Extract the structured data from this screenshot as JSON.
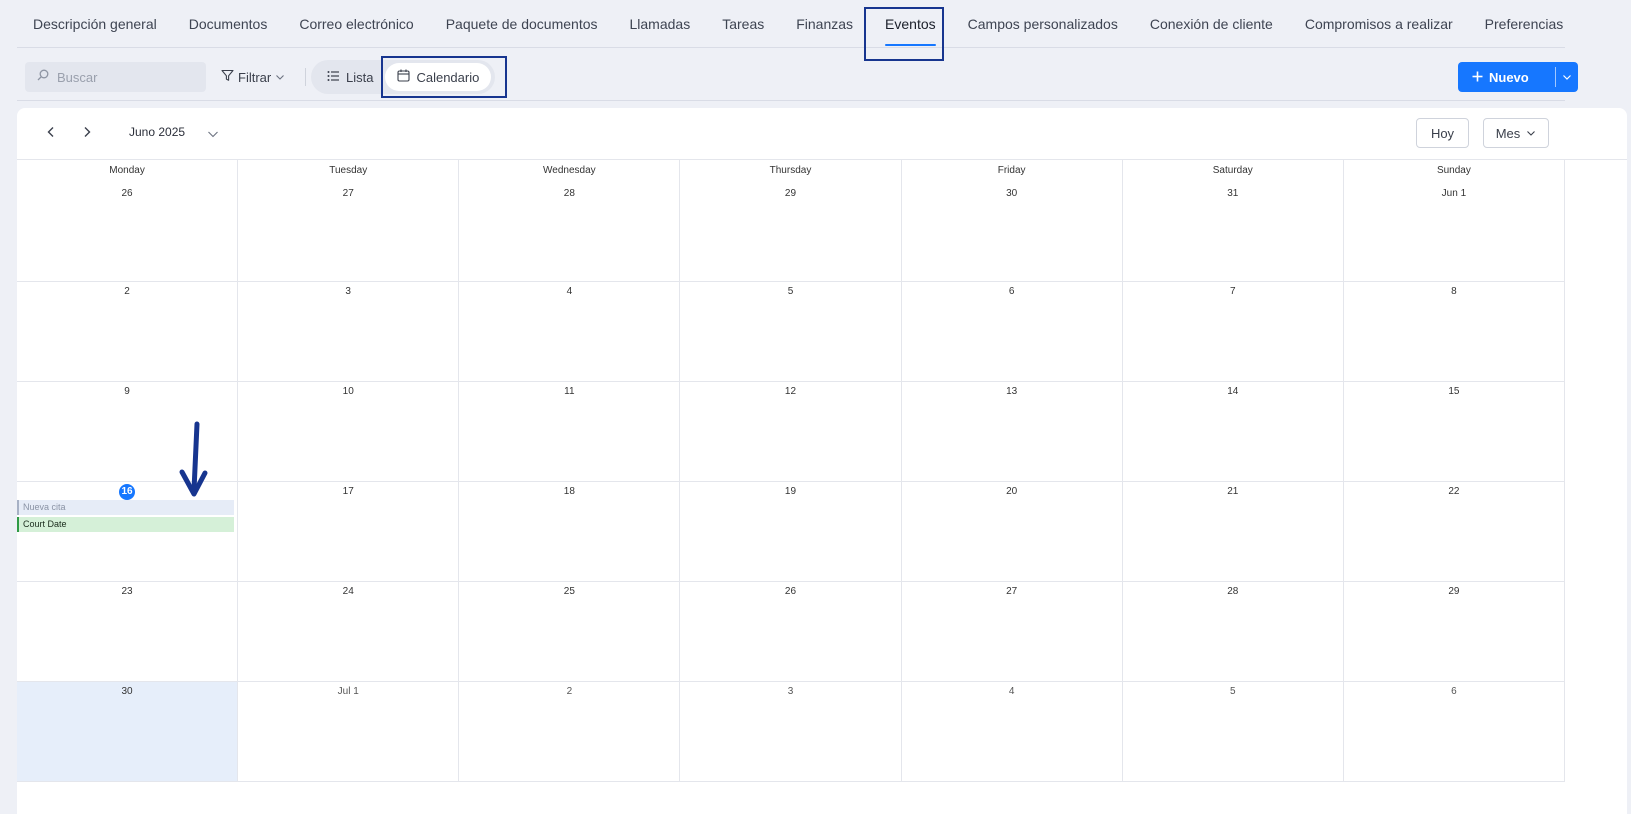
{
  "tabs": [
    {
      "label": "Descripción general"
    },
    {
      "label": "Documentos"
    },
    {
      "label": "Correo electrónico"
    },
    {
      "label": "Paquete de documentos"
    },
    {
      "label": "Llamadas"
    },
    {
      "label": "Tareas"
    },
    {
      "label": "Finanzas"
    },
    {
      "label": "Eventos",
      "active": true
    },
    {
      "label": "Campos personalizados"
    },
    {
      "label": "Conexión de cliente"
    },
    {
      "label": "Compromisos a realizar"
    },
    {
      "label": "Preferencias"
    }
  ],
  "toolbar": {
    "search_placeholder": "Buscar",
    "filter_label": "Filtrar",
    "list_label": "Lista",
    "calendar_label": "Calendario",
    "new_label": "Nuevo"
  },
  "calendar": {
    "month_label": "Juno 2025",
    "today_button": "Hoy",
    "view_button": "Mes",
    "weekdays": [
      "Monday",
      "Tuesday",
      "Wednesday",
      "Thursday",
      "Friday",
      "Saturday",
      "Sunday"
    ],
    "weeks": [
      [
        "26",
        "27",
        "28",
        "29",
        "30",
        "31",
        "Jun 1"
      ],
      [
        "2",
        "3",
        "4",
        "5",
        "6",
        "7",
        "8"
      ],
      [
        "9",
        "10",
        "11",
        "12",
        "13",
        "14",
        "15"
      ],
      [
        "16",
        "17",
        "18",
        "19",
        "20",
        "21",
        "22"
      ],
      [
        "23",
        "24",
        "25",
        "26",
        "27",
        "28",
        "29"
      ],
      [
        "30",
        "Jul 1",
        "2",
        "3",
        "4",
        "5",
        "6"
      ]
    ],
    "today": "16",
    "events": [
      {
        "title": "Nueva cita",
        "status": "pending"
      },
      {
        "title": "Court Date",
        "status": "confirmed"
      }
    ]
  },
  "colors": {
    "accent": "#1677ff",
    "highlight": "#17358f",
    "event_pending": "#e6ecf7",
    "event_confirmed": "#d5f0d8"
  }
}
